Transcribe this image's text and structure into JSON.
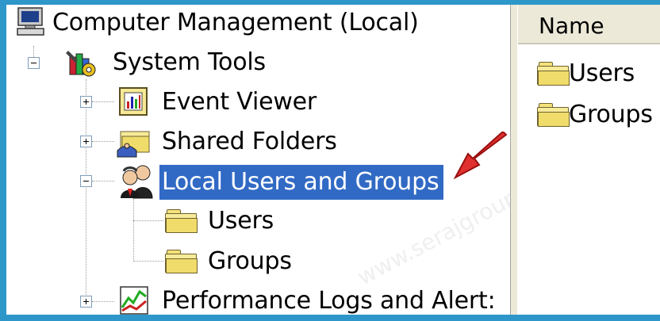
{
  "tree": {
    "root_label": "Computer Management (Local)",
    "system_tools_label": "System Tools",
    "event_viewer_label": "Event Viewer",
    "shared_folders_label": "Shared Folders",
    "local_users_label": "Local Users and Groups",
    "users_label": "Users",
    "groups_label": "Groups",
    "performance_label": "Performance Logs and Alert:"
  },
  "list": {
    "column_name": "Name",
    "items": [
      "Users",
      "Groups"
    ]
  },
  "watermark": "www.serajgroup.ir",
  "colors": {
    "selection": "#316ac5",
    "frame": "#2d97ca",
    "arrow": "#d62a2a"
  }
}
